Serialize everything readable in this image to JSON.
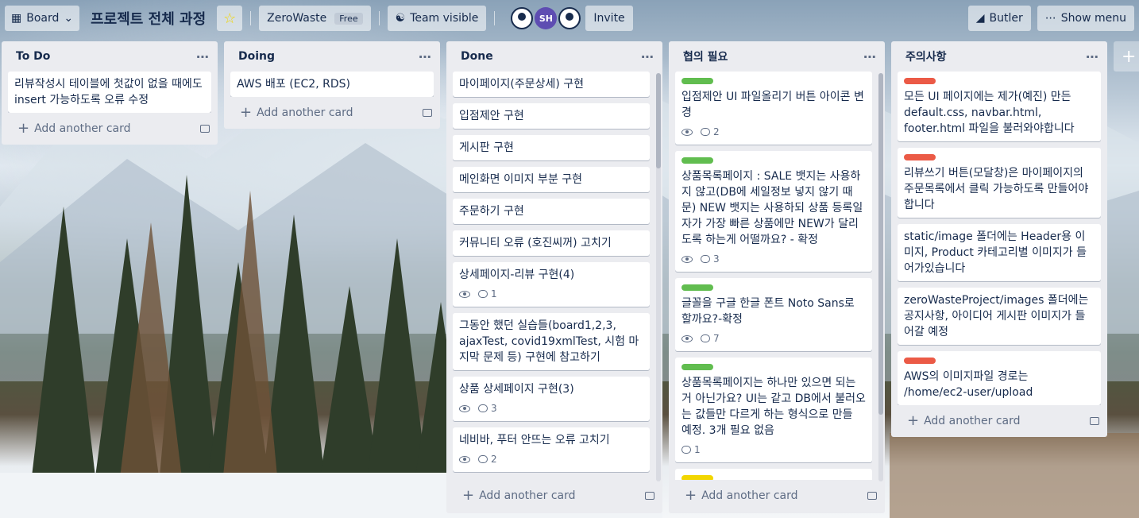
{
  "header": {
    "board_switch": "Board",
    "title": "프로젝트 전체 과정",
    "workspace": "ZeroWaste",
    "workspace_plan": "Free",
    "visibility": "Team visible",
    "member_initials": "SH",
    "invite": "Invite",
    "butler": "Butler",
    "show_menu": "Show menu"
  },
  "lists": [
    {
      "title": "To Do",
      "cards": [
        {
          "text": "리뷰작성시 테이블에 첫값이 없을 때에도 insert 가능하도록 오류 수정"
        }
      ],
      "add_label": "Add another card"
    },
    {
      "title": "Doing",
      "cards": [
        {
          "text": "AWS 배포 (EC2, RDS)"
        }
      ],
      "add_label": "Add another card"
    },
    {
      "title": "Done",
      "cards": [
        {
          "text": "마이페이지(주문상세) 구현"
        },
        {
          "text": "입점제안 구현"
        },
        {
          "text": "게시판 구현"
        },
        {
          "text": "메인화면 이미지 부분 구현"
        },
        {
          "text": "주문하기 구현"
        },
        {
          "text": "커뮤니티 오류 (호진씨꺼) 고치기"
        },
        {
          "text": "상세페이지-리뷰 구현(4)",
          "comments": "1"
        },
        {
          "text": "그동안 했던 실습들(board1,2,3, ajaxTest, covid19xmlTest, 시험 마지막 문제 등) 구현에 참고하기"
        },
        {
          "text": "상품 상세페이지 구현(3)",
          "comments": "3"
        },
        {
          "text": "네비바, 푸터 안뜨는 오류 고치기",
          "comments": "2"
        }
      ],
      "add_label": "Add another card"
    },
    {
      "title": "협의 필요",
      "cards": [
        {
          "label": "green",
          "text": "입점제안 UI 파일올리기 버튼 아이콘 변경",
          "comments": "2"
        },
        {
          "label": "green",
          "text": "상품목록페이지 : SALE 뱃지는 사용하지 않고(DB에 세일정보 넣지 않기 때문) NEW 뱃지는 사용하되 상품 등록일자가 가장 빠른 상품에만 NEW가 달리도록 하는게 어떨까요? - 확정",
          "comments": "3"
        },
        {
          "label": "green",
          "text": "글꼴을 구글 한글 폰트 Noto Sans로 할까요?-확정",
          "comments": "7"
        },
        {
          "label": "green",
          "text": "상품목록페이지는 하나만 있으면 되는거 아닌가요? UI는 같고 DB에서 불러오는 값들만 다르게 하는 형식으로 만들 예정. 3개 필요 없음",
          "comments": "1"
        },
        {
          "label": "yellow",
          "text": ""
        }
      ],
      "add_label": "Add another card"
    },
    {
      "title": "주의사항",
      "cards": [
        {
          "label": "red",
          "text": "모든 UI 페이지에는 제가(예진) 만든 default.css, navbar.html, footer.html 파일을 불러와야합니다"
        },
        {
          "label": "red",
          "text": "리뷰쓰기 버튼(모달창)은 마이페이지의 주문목록에서 클릭 가능하도록 만들어야합니다"
        },
        {
          "text": "static/image 폴더에는 Header용 이미지, Product 카테고리별 이미지가 들어가있습니다"
        },
        {
          "text": "zeroWasteProject/images 폴더에는 공지사항, 아이디어 게시판 이미지가 들어갈 예정"
        },
        {
          "label": "red",
          "text": "AWS의 이미지파일 경로는 /home/ec2-user/upload"
        }
      ],
      "add_label": "Add another card"
    }
  ],
  "add_list": "+",
  "colors": {
    "label_green": "#61bd4f",
    "label_red": "#eb5a46",
    "label_yellow": "#f2d600",
    "list_bg": "#ebecf0",
    "star": "#f2d600"
  }
}
